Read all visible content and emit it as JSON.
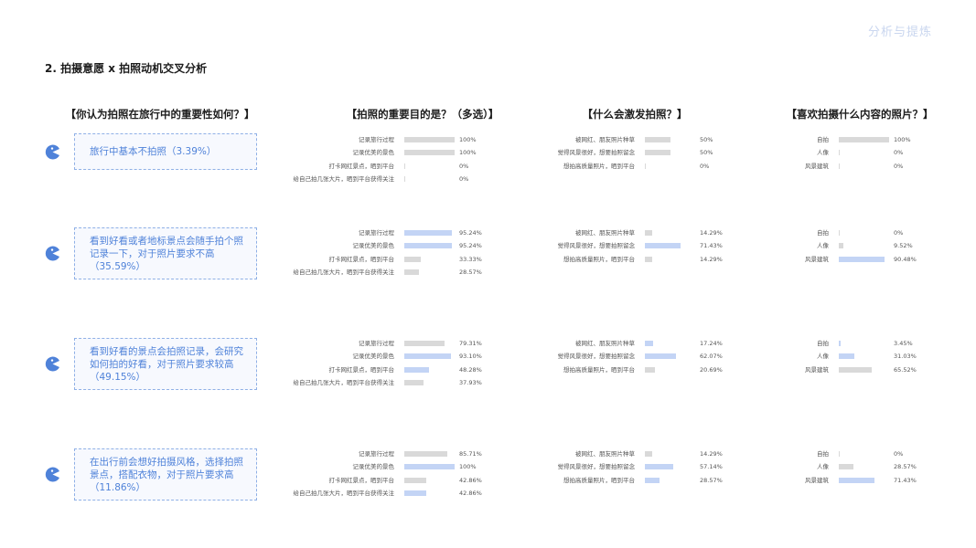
{
  "corner_label": "分析与提炼",
  "section_title": "2. 拍摄意愿 x 拍照动机交叉分析",
  "headers": [
    "【你认为拍照在旅行中的重要性如何？】",
    "【拍照的重要目的是？（多选）】",
    "【什么会激发拍照？】",
    "【喜欢拍摄什么内容的照片？】"
  ],
  "colors": {
    "accent": "#4f82d9",
    "bar_gray": "#d9d9d9",
    "bar_blue": "#c3d4f5"
  },
  "chart_data": {
    "type": "bar",
    "groups": [
      {
        "attitude": "旅行中基本不拍照（3.39%）",
        "purpose": [
          {
            "label": "记录旅行过程",
            "value": 100,
            "display": "100%",
            "highlight": false
          },
          {
            "label": "记录优美的景色",
            "value": 100,
            "display": "100%",
            "highlight": false
          },
          {
            "label": "打卡网红景点，晒到平台",
            "value": 0,
            "display": "0%",
            "highlight": false
          },
          {
            "label": "给自己拍几张大片，晒到平台获得关注",
            "value": 0,
            "display": "0%",
            "highlight": false
          }
        ],
        "trigger": [
          {
            "label": "被网红、朋友照片种草",
            "value": 50,
            "display": "50%",
            "highlight": false
          },
          {
            "label": "觉得风景很好，想要拍照留念",
            "value": 50,
            "display": "50%",
            "highlight": false
          },
          {
            "label": "想拍高质量照片，晒到平台",
            "value": 0,
            "display": "0%",
            "highlight": false
          }
        ],
        "content": [
          {
            "label": "自拍",
            "value": 100,
            "display": "100%",
            "highlight": false
          },
          {
            "label": "人像",
            "value": 0,
            "display": "0%",
            "highlight": false
          },
          {
            "label": "风景建筑",
            "value": 0,
            "display": "0%",
            "highlight": false
          }
        ]
      },
      {
        "attitude": "看到好看或者地标景点会随手拍个照记录一下，对于照片要求不高（35.59%）",
        "purpose": [
          {
            "label": "记录旅行过程",
            "value": 95.24,
            "display": "95.24%",
            "highlight": true
          },
          {
            "label": "记录优美的景色",
            "value": 95.24,
            "display": "95.24%",
            "highlight": true
          },
          {
            "label": "打卡网红景点，晒到平台",
            "value": 33.33,
            "display": "33.33%",
            "highlight": false
          },
          {
            "label": "给自己拍几张大片，晒到平台获得关注",
            "value": 28.57,
            "display": "28.57%",
            "highlight": false
          }
        ],
        "trigger": [
          {
            "label": "被网红、朋友照片种草",
            "value": 14.29,
            "display": "14.29%",
            "highlight": false
          },
          {
            "label": "觉得风景很好，想要拍照留念",
            "value": 71.43,
            "display": "71.43%",
            "highlight": true
          },
          {
            "label": "想拍高质量照片，晒到平台",
            "value": 14.29,
            "display": "14.29%",
            "highlight": false
          }
        ],
        "content": [
          {
            "label": "自拍",
            "value": 0,
            "display": "0%",
            "highlight": false
          },
          {
            "label": "人像",
            "value": 9.52,
            "display": "9.52%",
            "highlight": false
          },
          {
            "label": "风景建筑",
            "value": 90.48,
            "display": "90.48%",
            "highlight": true
          }
        ]
      },
      {
        "attitude": "看到好看的景点会拍照记录，会研究如何拍的好看，对于照片要求较高（49.15%）",
        "purpose": [
          {
            "label": "记录旅行过程",
            "value": 79.31,
            "display": "79.31%",
            "highlight": false
          },
          {
            "label": "记录优美的景色",
            "value": 93.1,
            "display": "93.10%",
            "highlight": true
          },
          {
            "label": "打卡网红景点，晒到平台",
            "value": 48.28,
            "display": "48.28%",
            "highlight": true
          },
          {
            "label": "给自己拍几张大片，晒到平台获得关注",
            "value": 37.93,
            "display": "37.93%",
            "highlight": false
          }
        ],
        "trigger": [
          {
            "label": "被网红、朋友照片种草",
            "value": 17.24,
            "display": "17.24%",
            "highlight": true
          },
          {
            "label": "觉得风景很好，想要拍照留念",
            "value": 62.07,
            "display": "62.07%",
            "highlight": true
          },
          {
            "label": "想拍高质量照片，晒到平台",
            "value": 20.69,
            "display": "20.69%",
            "highlight": false
          }
        ],
        "content": [
          {
            "label": "自拍",
            "value": 3.45,
            "display": "3.45%",
            "highlight": true
          },
          {
            "label": "人像",
            "value": 31.03,
            "display": "31.03%",
            "highlight": true
          },
          {
            "label": "风景建筑",
            "value": 65.52,
            "display": "65.52%",
            "highlight": false
          }
        ]
      },
      {
        "attitude": "在出行前会想好拍摄风格，选择拍照景点，搭配衣物，对于照片要求高（11.86%）",
        "purpose": [
          {
            "label": "记录旅行过程",
            "value": 85.71,
            "display": "85.71%",
            "highlight": false
          },
          {
            "label": "记录优美的景色",
            "value": 100,
            "display": "100%",
            "highlight": true
          },
          {
            "label": "打卡网红景点，晒到平台",
            "value": 42.86,
            "display": "42.86%",
            "highlight": false
          },
          {
            "label": "给自己拍几张大片，晒到平台获得关注",
            "value": 42.86,
            "display": "42.86%",
            "highlight": true
          }
        ],
        "trigger": [
          {
            "label": "被网红、朋友照片种草",
            "value": 14.29,
            "display": "14.29%",
            "highlight": false
          },
          {
            "label": "觉得风景很好，想要拍照留念",
            "value": 57.14,
            "display": "57.14%",
            "highlight": true
          },
          {
            "label": "想拍高质量照片，晒到平台",
            "value": 28.57,
            "display": "28.57%",
            "highlight": true
          }
        ],
        "content": [
          {
            "label": "自拍",
            "value": 0,
            "display": "0%",
            "highlight": false
          },
          {
            "label": "人像",
            "value": 28.57,
            "display": "28.57%",
            "highlight": false
          },
          {
            "label": "风景建筑",
            "value": 71.43,
            "display": "71.43%",
            "highlight": true
          }
        ]
      }
    ]
  }
}
